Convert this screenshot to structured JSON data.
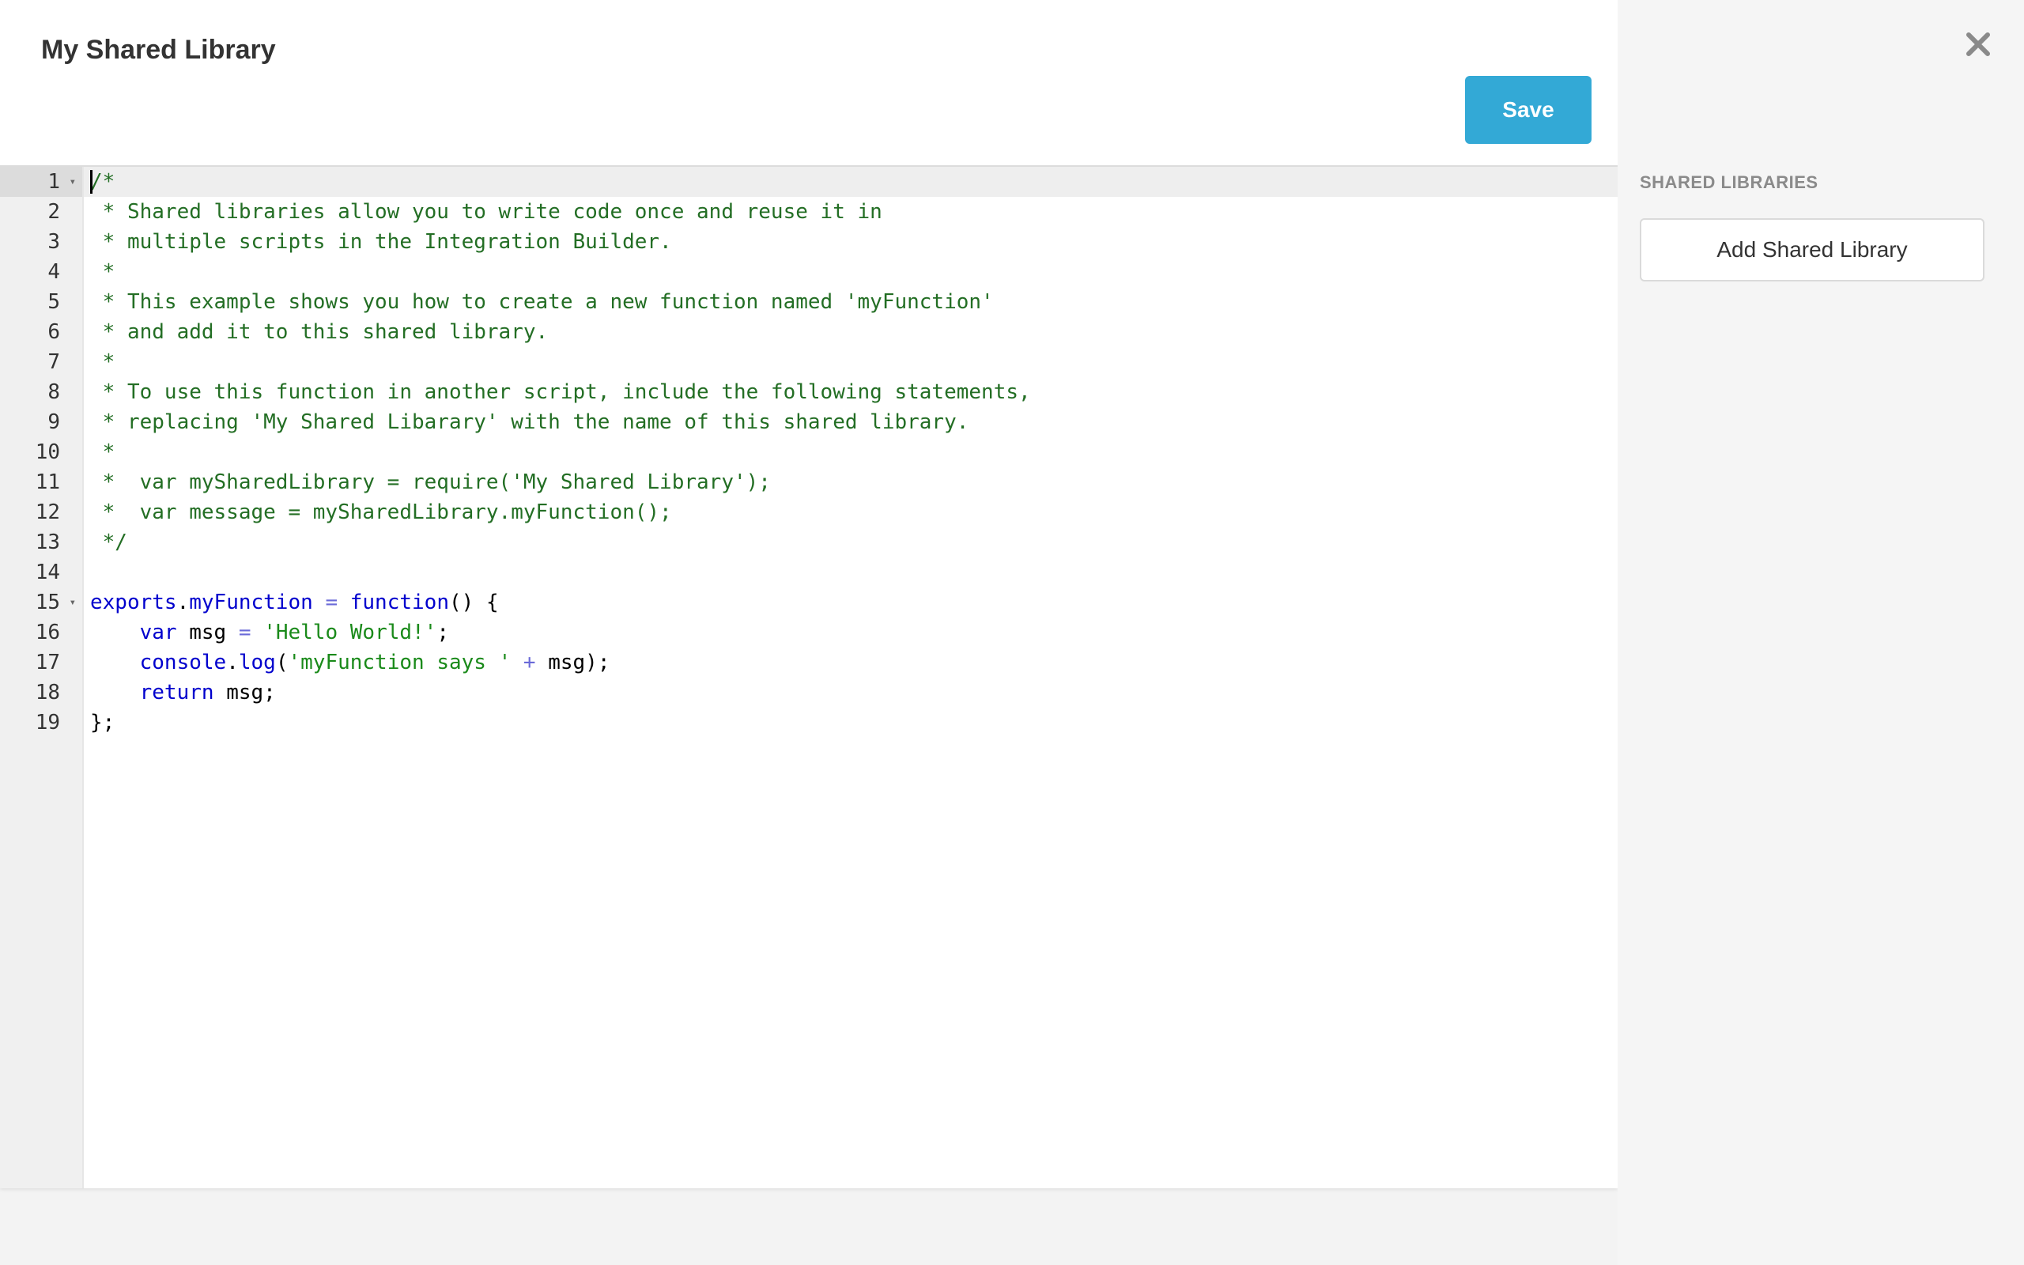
{
  "header": {
    "title": "My Shared Library",
    "save_label": "Save"
  },
  "side_panel": {
    "heading": "SHARED LIBRARIES",
    "add_button_label": "Add Shared Library"
  },
  "icons": {
    "close": "close-icon",
    "fold": "fold-arrow-icon"
  },
  "colors": {
    "accent": "#33a9d6",
    "comment": "#236e24",
    "keyword": "#0000cd",
    "string": "#1a8a1a"
  },
  "editor": {
    "active_line": 1,
    "fold_lines": [
      1,
      15
    ],
    "lines": [
      [
        {
          "t": "/*",
          "c": "comment"
        }
      ],
      [
        {
          "t": " * Shared libraries allow you to write code once and reuse it in",
          "c": "comment"
        }
      ],
      [
        {
          "t": " * multiple scripts in the Integration Builder.",
          "c": "comment"
        }
      ],
      [
        {
          "t": " *",
          "c": "comment"
        }
      ],
      [
        {
          "t": " * This example shows you how to create a new function named 'myFunction'",
          "c": "comment"
        }
      ],
      [
        {
          "t": " * and add it to this shared library.",
          "c": "comment"
        }
      ],
      [
        {
          "t": " *",
          "c": "comment"
        }
      ],
      [
        {
          "t": " * To use this function in another script, include the following statements,",
          "c": "comment"
        }
      ],
      [
        {
          "t": " * replacing 'My Shared Libarary' with the name of this shared library.",
          "c": "comment"
        }
      ],
      [
        {
          "t": " *",
          "c": "comment"
        }
      ],
      [
        {
          "t": " *  var mySharedLibrary = require('My Shared Library');",
          "c": "comment"
        }
      ],
      [
        {
          "t": " *  var message = mySharedLibrary.myFunction();",
          "c": "comment"
        }
      ],
      [
        {
          "t": " */",
          "c": "comment"
        }
      ],
      [],
      [
        {
          "t": "exports",
          "c": "keyword"
        },
        {
          "t": ".",
          "c": "plain"
        },
        {
          "t": "myFunction",
          "c": "keyword"
        },
        {
          "t": " ",
          "c": "plain"
        },
        {
          "t": "=",
          "c": "op"
        },
        {
          "t": " ",
          "c": "plain"
        },
        {
          "t": "function",
          "c": "keyword"
        },
        {
          "t": "() {",
          "c": "plain"
        }
      ],
      [
        {
          "t": "    ",
          "c": "plain"
        },
        {
          "t": "var",
          "c": "keyword"
        },
        {
          "t": " msg ",
          "c": "plain"
        },
        {
          "t": "=",
          "c": "op"
        },
        {
          "t": " ",
          "c": "plain"
        },
        {
          "t": "'Hello World!'",
          "c": "string"
        },
        {
          "t": ";",
          "c": "plain"
        }
      ],
      [
        {
          "t": "    ",
          "c": "plain"
        },
        {
          "t": "console",
          "c": "keyword"
        },
        {
          "t": ".",
          "c": "plain"
        },
        {
          "t": "log",
          "c": "keyword"
        },
        {
          "t": "(",
          "c": "plain"
        },
        {
          "t": "'myFunction says '",
          "c": "string"
        },
        {
          "t": " ",
          "c": "plain"
        },
        {
          "t": "+",
          "c": "op"
        },
        {
          "t": " msg);",
          "c": "plain"
        }
      ],
      [
        {
          "t": "    ",
          "c": "plain"
        },
        {
          "t": "return",
          "c": "keyword"
        },
        {
          "t": " msg;",
          "c": "plain"
        }
      ],
      [
        {
          "t": "};",
          "c": "plain"
        }
      ]
    ]
  }
}
